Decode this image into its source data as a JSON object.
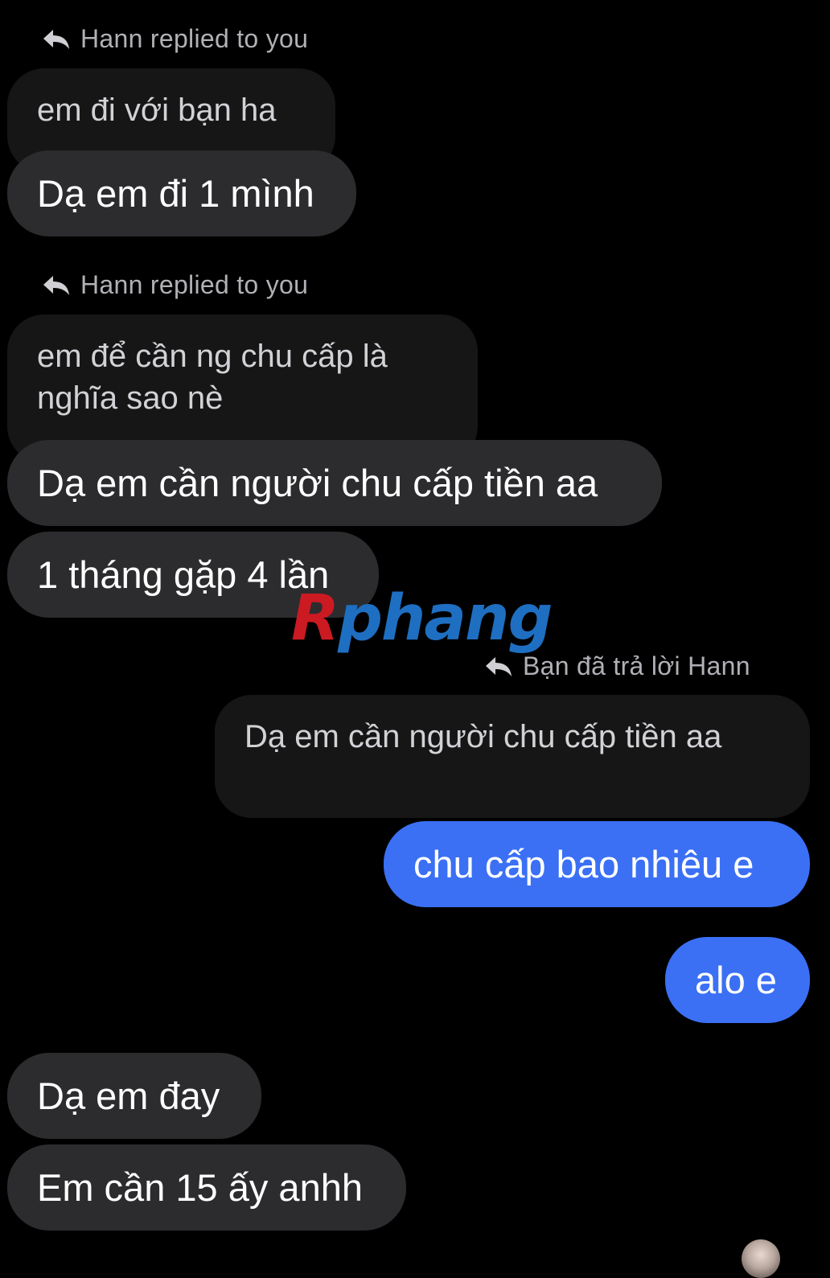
{
  "messages": {
    "reply1": {
      "header": "Hann replied to you",
      "quoted": "em đi với bạn ha",
      "message": "Dạ em đi 1 mình"
    },
    "reply2": {
      "header": "Hann replied to you",
      "quoted": "em để cần ng chu cấp là nghĩa sao nè",
      "message1": "Dạ em cần người chu cấp tiền aa",
      "message2": "1 tháng gặp 4 lần"
    },
    "reply3": {
      "header": "Bạn đã trả lời Hann",
      "quoted": "Dạ em cần người chu cấp tiền aa",
      "message1": "chu cấp bao nhiêu e",
      "message2": "alo e"
    },
    "incoming_end": {
      "message1": "Dạ em đay",
      "message2": "Em cần 15 ấy anhh"
    }
  },
  "watermark": {
    "first": "R",
    "rest": "phang"
  },
  "icons": {
    "reply": "reply-arrow-icon",
    "avatar": "contact-avatar"
  },
  "colors": {
    "background": "#000000",
    "incoming_bubble": "#2c2c2e",
    "outgoing_bubble": "#3b70f5",
    "quoted_bubble": "#161617",
    "reply_header_text": "#b0b0b6"
  }
}
